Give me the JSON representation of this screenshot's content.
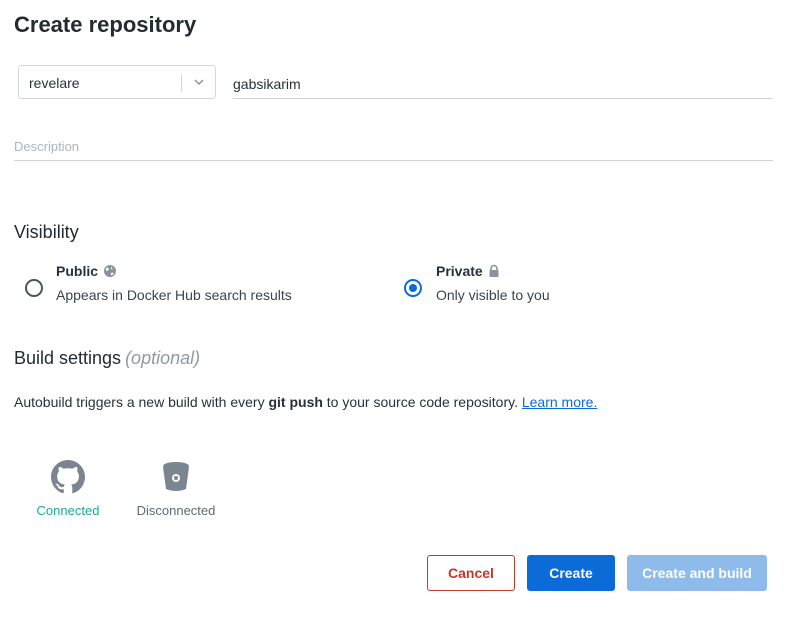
{
  "page": {
    "title": "Create repository"
  },
  "form": {
    "namespace": "revelare",
    "repo_name": "gabsikarim",
    "description_placeholder": "Description"
  },
  "visibility": {
    "title": "Visibility",
    "public": {
      "label": "Public",
      "description": "Appears in Docker Hub search results",
      "selected": false,
      "icon": "globe-icon"
    },
    "private": {
      "label": "Private",
      "description": "Only visible to you",
      "selected": true,
      "icon": "lock-icon"
    }
  },
  "build": {
    "title": "Build settings",
    "optional": "(optional)",
    "text_before": "Autobuild triggers a new build with every",
    "text_bold": "git push",
    "text_after": "to your source code repository.",
    "learn_more": "Learn more.",
    "providers": [
      {
        "name": "GitHub",
        "icon": "github-icon",
        "status": "Connected"
      },
      {
        "name": "Bitbucket",
        "icon": "bitbucket-icon",
        "status": "Disconnected"
      }
    ]
  },
  "actions": {
    "cancel": "Cancel",
    "create": "Create",
    "create_and_build": "Create and build"
  },
  "colors": {
    "primary": "#0b6cd8",
    "primary_disabled": "#8fbbea",
    "danger": "#c0392b",
    "connected": "#1aaa9c"
  }
}
